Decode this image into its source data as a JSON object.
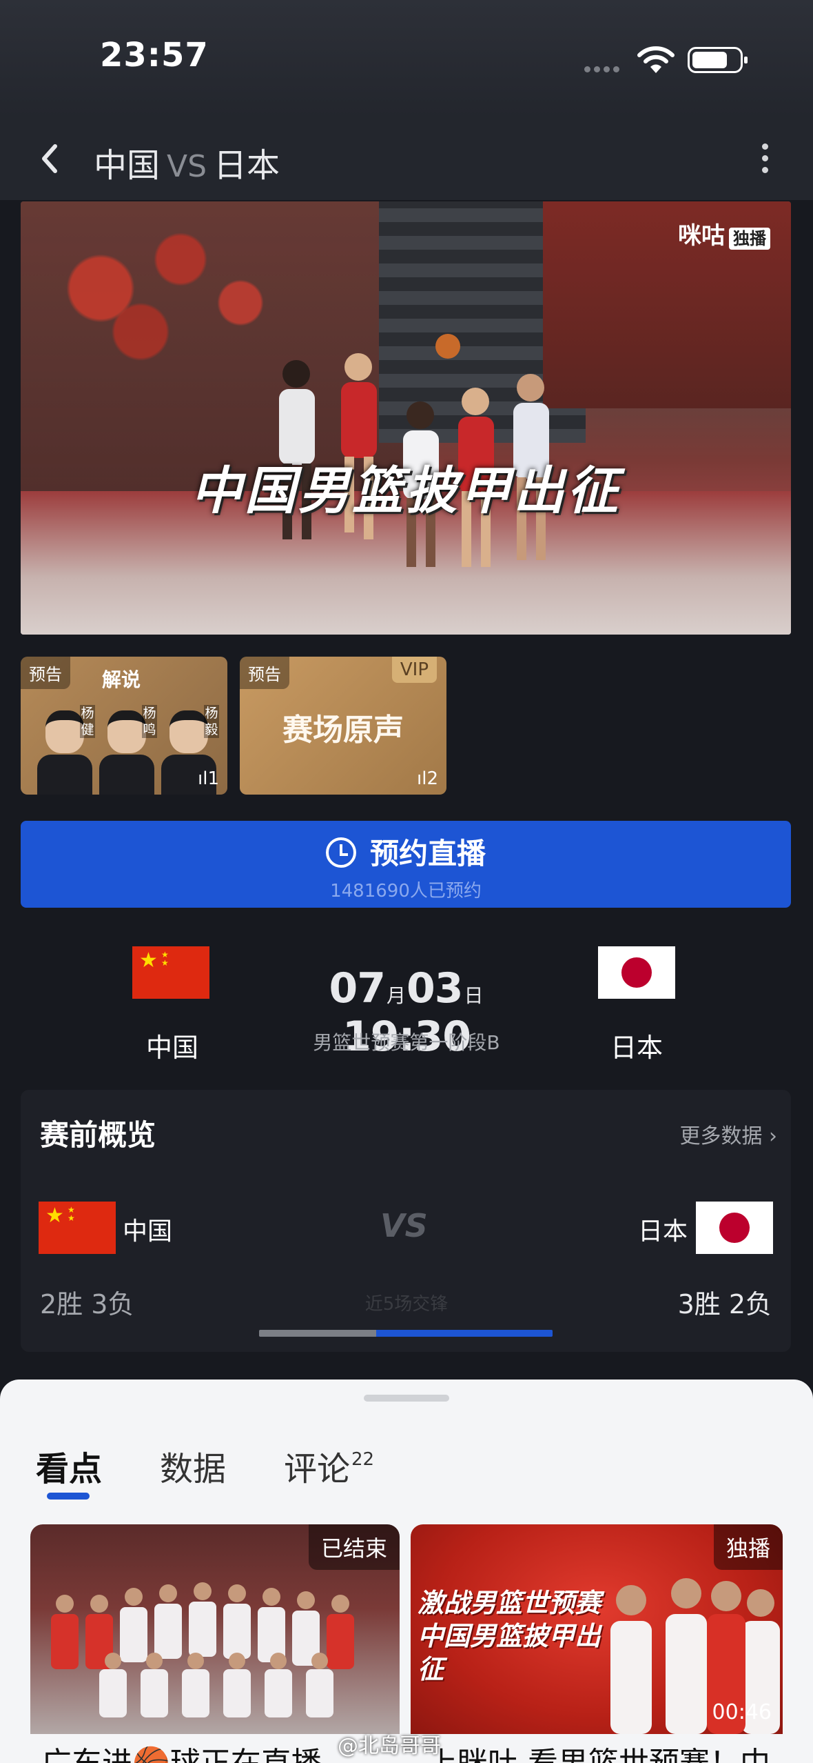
{
  "status_bar": {
    "time": "23:57"
  },
  "nav": {
    "team_a": "中国",
    "vs": "VS",
    "team_b": "日本"
  },
  "video": {
    "headline": "中国男篮披甲出征",
    "brand": "咪咕",
    "brand_badge": "独播"
  },
  "streams": [
    {
      "tag": "预告",
      "subtitle": "解说",
      "commentators": [
        "杨健",
        "杨鸣",
        "杨毅"
      ],
      "views": "1"
    },
    {
      "tag": "预告",
      "vip": "VIP",
      "label": "赛场原声",
      "views": "2"
    }
  ],
  "reserve": {
    "label": "预约直播",
    "count_text": "1481690人已预约"
  },
  "match": {
    "team_home": "中国",
    "team_away": "日本",
    "month": "07",
    "month_unit": "月",
    "day": "03",
    "day_unit": "日",
    "time": "19:30",
    "stage": "男篮世预赛第一阶段B"
  },
  "overview": {
    "title": "赛前概览",
    "more": "更多数据",
    "home_name": "中国",
    "away_name": "日本",
    "vs": "VS",
    "home_record": "2胜 3负",
    "away_record": "3胜 2负",
    "middle_label": "近5场交锋",
    "home_share": 0.4,
    "away_share": 0.6
  },
  "sheet": {
    "tabs": [
      {
        "label": "看点"
      },
      {
        "label": "数据"
      },
      {
        "label": "评论",
        "count": "22"
      }
    ],
    "videos": [
      {
        "badge": "已结束",
        "caption": "广东进🏀球正在直播"
      },
      {
        "badge": "独播",
        "overlay": "激战男篮世预赛 中国男篮披甲出征",
        "duration": "00:46",
        "caption": "上眯吐 看男篮世预赛！中"
      }
    ]
  },
  "watermark": "@北岛哥哥",
  "colors": {
    "accent": "#1d55d4",
    "background": "#17191f",
    "sheet": "#f4f5f7"
  }
}
